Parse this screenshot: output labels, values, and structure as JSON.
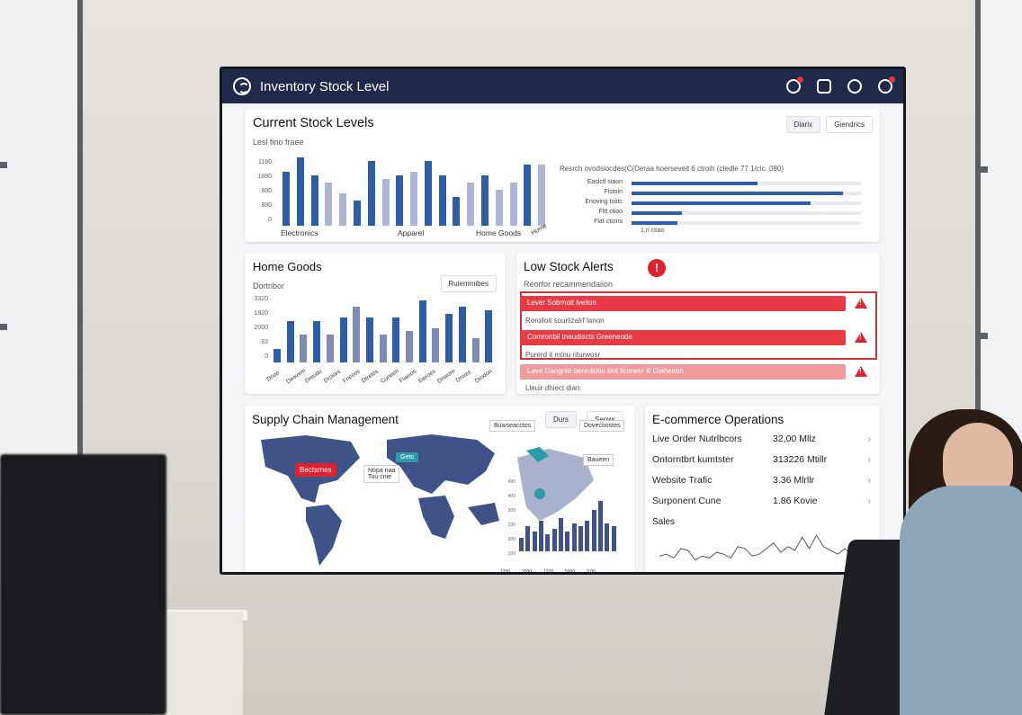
{
  "app": {
    "title": "Inventory Stock Level"
  },
  "header_icons": [
    "notification-icon",
    "window-icon",
    "settings-icon",
    "bell-icon"
  ],
  "current_stock": {
    "title": "Current Stock Levels",
    "subtitle": "Lesl fino fraee",
    "tabs": [
      "Dlarix",
      "Giendrics"
    ],
    "y_ticks": [
      "1180",
      "1880",
      "880",
      "880",
      "0"
    ],
    "categories": [
      "Electronics",
      "Apparel",
      "Home Goods"
    ],
    "bars": [
      0.75,
      0.95,
      0.7,
      0.6,
      0.45,
      0.35,
      0.9,
      0.65,
      0.7,
      0.75,
      0.9,
      0.7,
      0.4,
      0.6,
      0.7,
      0.5,
      0.6,
      0.85,
      0.85
    ],
    "bars_light": [
      false,
      false,
      false,
      true,
      true,
      false,
      false,
      true,
      false,
      true,
      false,
      false,
      false,
      true,
      false,
      true,
      true,
      false,
      true
    ],
    "corner_label": "Home",
    "rank_title": "Resrch ovodsiocdes(C(Deraa hoerseveit 6 ctroih (ctedle 77 1/cic. 080)",
    "rank_labels": [
      "Easlctl siaon",
      "Fistoin",
      "Enoving toiitc",
      "Fltt ctioo",
      "Flat ctions"
    ],
    "rank_values": [
      0.55,
      0.92,
      0.78,
      0.22,
      0.2
    ],
    "rank_footer": "1,ri  ctiao"
  },
  "home_goods": {
    "title": "Home Goods",
    "subtitle": "Dortribor",
    "button": "Ruiemmibes",
    "y_ticks": [
      "3320",
      "1820",
      "2000",
      "83",
      "0"
    ],
    "bars": [
      0.2,
      0.6,
      0.4,
      0.6,
      0.4,
      0.65,
      0.8,
      0.65,
      0.4,
      0.65,
      0.45,
      0.9,
      0.5,
      0.7,
      0.8,
      0.35,
      0.75
    ],
    "bars_light": [
      false,
      false,
      true,
      false,
      true,
      false,
      true,
      false,
      true,
      false,
      true,
      false,
      true,
      false,
      false,
      true,
      false
    ],
    "x_labels": [
      "Drioo",
      "Deavem",
      "Dreodo",
      "Droiors",
      "Fneoos",
      "Dtretos",
      "Coneen",
      "Flaeios",
      "Ewroes",
      "Dnwore",
      "Droies",
      "Drodon"
    ]
  },
  "low_stock": {
    "title": "Low Stock Alerts",
    "subtitle": "Reorfor recammendaiion",
    "alerts": [
      {
        "text": "Lever Sobrnoit ivelion",
        "tone": "strong"
      },
      {
        "text": "Comronbil tneudiscts Greeneode",
        "tone": "strong"
      },
      {
        "text": "Lave Dangnie berediotlo tinil ilciewer ili Dolneeon",
        "tone": "light"
      }
    ],
    "notes": [
      "Rorolloit sourlizalrf lanon",
      "Purerd it mtnu riturwosr",
      "Lleuir dhiect dian"
    ]
  },
  "supply_chain": {
    "title": "Supply Chain Management",
    "tabs": [
      "Durs",
      "Seowr"
    ],
    "map_labels": [
      "Bectsrnes",
      "Nopa naa\nTou cnie",
      "Geto",
      "Buwseacctos",
      "Dovecoostes",
      "Baueen"
    ],
    "bars": [
      0.25,
      0.45,
      0.35,
      0.55,
      0.3,
      0.4,
      0.6,
      0.35,
      0.5,
      0.45,
      0.55,
      0.75,
      0.9,
      0.5,
      0.45
    ],
    "x_ticks": [
      "1250",
      "2000",
      "1270",
      "5000",
      "2,00"
    ],
    "y_ticks": [
      "490",
      "400",
      "300",
      "230",
      "200",
      "100"
    ]
  },
  "ecommerce": {
    "title": "E-commerce Operations",
    "metrics": [
      {
        "label": "Live Order Nutrlbcors",
        "value": "32,00 Mllz"
      },
      {
        "label": "Ontorntbrt kumtster",
        "value": "313226 Mtillr"
      },
      {
        "label": "Website Trafic",
        "value": "3.36 Mlrllr"
      },
      {
        "label": "Surponent Cune",
        "value": "1.86 Kovie"
      }
    ],
    "sales_label": "Sales",
    "sales_series": [
      0.35,
      0.4,
      0.3,
      0.55,
      0.5,
      0.25,
      0.35,
      0.3,
      0.45,
      0.4,
      0.3,
      0.6,
      0.55,
      0.35,
      0.4,
      0.55,
      0.7,
      0.45,
      0.6,
      0.5,
      0.85,
      0.55,
      0.9,
      0.6,
      0.5,
      0.4,
      0.55,
      0.35,
      0.4,
      0.45
    ]
  },
  "colors": {
    "accent": "#2f5ea8",
    "light_bar": "#aeb6d6",
    "alert": "#e83a44",
    "alert_light": "#f19a9e",
    "titlebar": "#1f2a4a",
    "map": "#3f5388"
  }
}
